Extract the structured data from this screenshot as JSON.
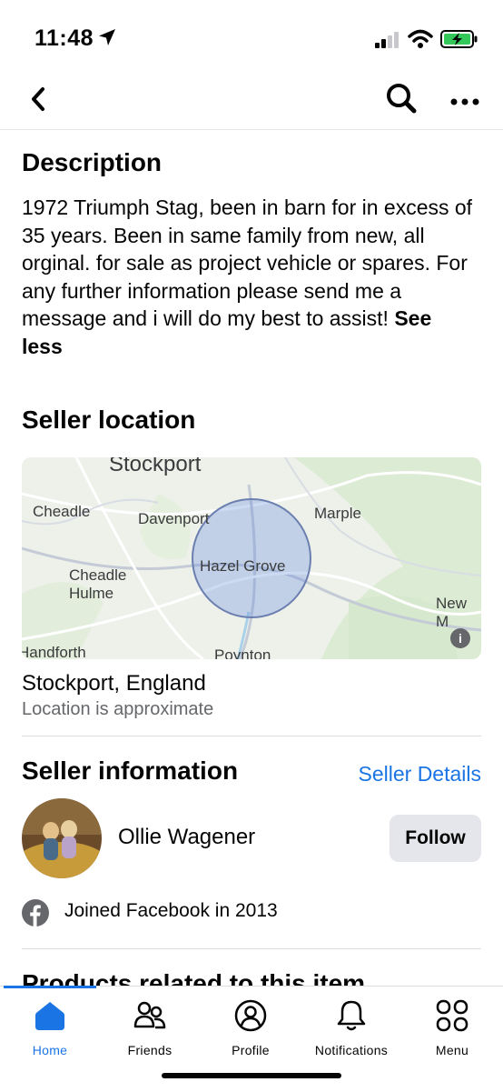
{
  "status_bar": {
    "time": "11:48",
    "battery_color": "#34c759"
  },
  "nav": {
    "back_icon": "chevron-left-icon",
    "search_icon": "search-icon",
    "more_icon": "more-icon"
  },
  "description": {
    "title": "Description",
    "text": "1972 Triumph Stag, been in barn for in excess of 35 years. Been in same family from new, all orginal. for sale as project vehicle or spares. For any further information please send me a message and i will do my best to assist! ",
    "see_less": "See less"
  },
  "seller_location": {
    "title": "Seller location",
    "map_labels": [
      "Stockport",
      "Cheadle",
      "Davenport",
      "Marple",
      "Cheadle Hulme",
      "Hazel Grove",
      "New M",
      "Handforth",
      "Poynton"
    ],
    "location": "Stockport, England",
    "note": "Location is approximate"
  },
  "seller_information": {
    "title": "Seller information",
    "details_link": "Seller Details",
    "name": "Ollie Wagener",
    "follow_label": "Follow",
    "joined": "Joined Facebook in 2013"
  },
  "related": {
    "title": "Products related to this item"
  },
  "tabs": [
    {
      "label": "Home",
      "icon": "home-icon",
      "active": true
    },
    {
      "label": "Friends",
      "icon": "friends-icon",
      "active": false
    },
    {
      "label": "Profile",
      "icon": "profile-icon",
      "active": false
    },
    {
      "label": "Notifications",
      "icon": "bell-icon",
      "active": false
    },
    {
      "label": "Menu",
      "icon": "menu-icon",
      "active": false
    }
  ],
  "colors": {
    "accent": "#1b74e4",
    "secondary_text": "#65676b",
    "button_bg": "#e4e6eb"
  }
}
